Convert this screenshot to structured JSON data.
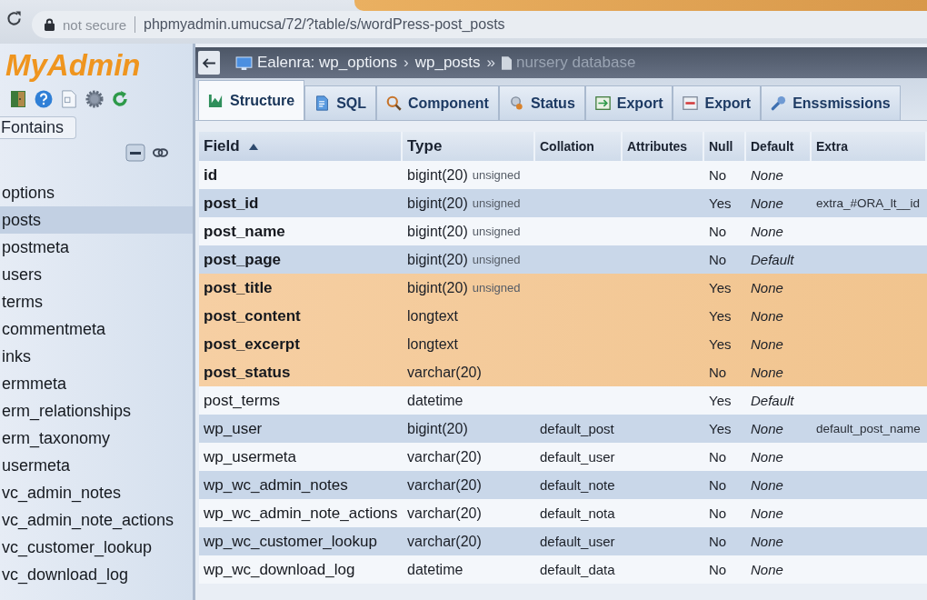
{
  "browser": {
    "security_label": "not secure",
    "url": "phpmyadmin.umucsa/72/?table/s/wordPress-post_posts"
  },
  "sidebar": {
    "logo": "MyAdmin",
    "filter": {
      "value": "Fontains"
    },
    "items": [
      {
        "label": "options",
        "selected": false
      },
      {
        "label": "posts",
        "selected": true
      },
      {
        "label": "postmeta",
        "selected": false
      },
      {
        "label": "users",
        "selected": false
      },
      {
        "label": "terms",
        "selected": false
      },
      {
        "label": "commentmeta",
        "selected": false
      },
      {
        "label": "inks",
        "selected": false
      },
      {
        "label": "ermmeta",
        "selected": false
      },
      {
        "label": "erm_relationships",
        "selected": false
      },
      {
        "label": "erm_taxonomy",
        "selected": false
      },
      {
        "label": "usermeta",
        "selected": false
      },
      {
        "label": "vc_admin_notes",
        "selected": false
      },
      {
        "label": "vc_admin_note_actions",
        "selected": false
      },
      {
        "label": "vc_customer_lookup",
        "selected": false
      },
      {
        "label": "vc_download_log",
        "selected": false
      }
    ]
  },
  "breadcrumb": [
    {
      "kind": "server",
      "label": "Ealenra: wp_options",
      "separator": "›"
    },
    {
      "kind": "table",
      "label": "wp_posts",
      "separator": "»"
    },
    {
      "kind": "database",
      "label": "nursery database"
    }
  ],
  "tabs": [
    {
      "label": "Structure",
      "selected": true
    },
    {
      "label": "SQL",
      "selected": false
    },
    {
      "label": "Component",
      "selected": false
    },
    {
      "label": "Status",
      "selected": false
    },
    {
      "label": "Export",
      "selected": false
    },
    {
      "label": "Export",
      "selected": false
    },
    {
      "label": "Enssmissions",
      "selected": false
    }
  ],
  "table": {
    "columns": [
      {
        "label": "Field",
        "sorted": true
      },
      {
        "label": "Type",
        "sorted": false
      },
      {
        "label": "Collation",
        "sorted": false
      },
      {
        "label": "Attributes",
        "sorted": false
      },
      {
        "label": "Null",
        "sorted": false
      },
      {
        "label": "Default",
        "sorted": false
      },
      {
        "label": "Extra",
        "sorted": false
      }
    ],
    "rows": [
      {
        "field": "id",
        "type": "bigint(20)",
        "type_note": "unsigned",
        "null": "No",
        "default": "None",
        "emphasized": true,
        "highlighted": false
      },
      {
        "field": "post_id",
        "type": "bigint(20)",
        "type_note": "unsigned",
        "null": "Yes",
        "default": "None",
        "extra": "extra_#ORA_lt__id",
        "emphasized": true,
        "highlighted": false
      },
      {
        "field": "post_name",
        "type": "bigint(20)",
        "type_note": "unsigned",
        "null": "No",
        "default": "None",
        "emphasized": true,
        "highlighted": false
      },
      {
        "field": "post_page",
        "type": "bigint(20)",
        "type_note": "unsigned",
        "null": "No",
        "default": "Default",
        "emphasized": true,
        "highlighted": false
      },
      {
        "field": "post_title",
        "type": "bigint(20)",
        "type_note": "unsigned",
        "null": "Yes",
        "default": "None",
        "emphasized": true,
        "highlighted": true
      },
      {
        "field": "post_content",
        "type": "longtext",
        "null": "Yes",
        "default": "None",
        "emphasized": true,
        "highlighted": true
      },
      {
        "field": "post_excerpt",
        "type": "longtext",
        "null": "Yes",
        "default": "None",
        "emphasized": true,
        "highlighted": true
      },
      {
        "field": "post_status",
        "type": "varchar(20)",
        "null": "No",
        "default": "None",
        "emphasized": true,
        "highlighted": true
      },
      {
        "field": "post_terms",
        "type": "datetime",
        "null": "Yes",
        "default": "Default",
        "emphasized": false,
        "highlighted": false
      },
      {
        "field": "wp_user",
        "type": "bigint(20)",
        "collation": "default_post",
        "null": "Yes",
        "default": "None",
        "extra": "default_post_name",
        "emphasized": false,
        "highlighted": false
      },
      {
        "field": "wp_usermeta",
        "type": "varchar(20)",
        "collation": "default_user",
        "null": "No",
        "default": "None",
        "emphasized": false,
        "highlighted": false
      },
      {
        "field": "wp_wc_admin_notes",
        "type": "varchar(20)",
        "collation": "default_note",
        "null": "No",
        "default": "None",
        "emphasized": false,
        "highlighted": false
      },
      {
        "field": "wp_wc_admin_note_actions",
        "type": "varchar(20)",
        "collation": "default_nota",
        "null": "No",
        "default": "None",
        "emphasized": false,
        "highlighted": false
      },
      {
        "field": "wp_wc_customer_lookup",
        "type": "varchar(20)",
        "collation": "default_user",
        "null": "No",
        "default": "None",
        "emphasized": false,
        "highlighted": false
      },
      {
        "field": "wp_wc_download_log",
        "type": "datetime",
        "collation": "default_data",
        "null": "No",
        "default": "None",
        "emphasized": false,
        "highlighted": false
      }
    ]
  }
}
